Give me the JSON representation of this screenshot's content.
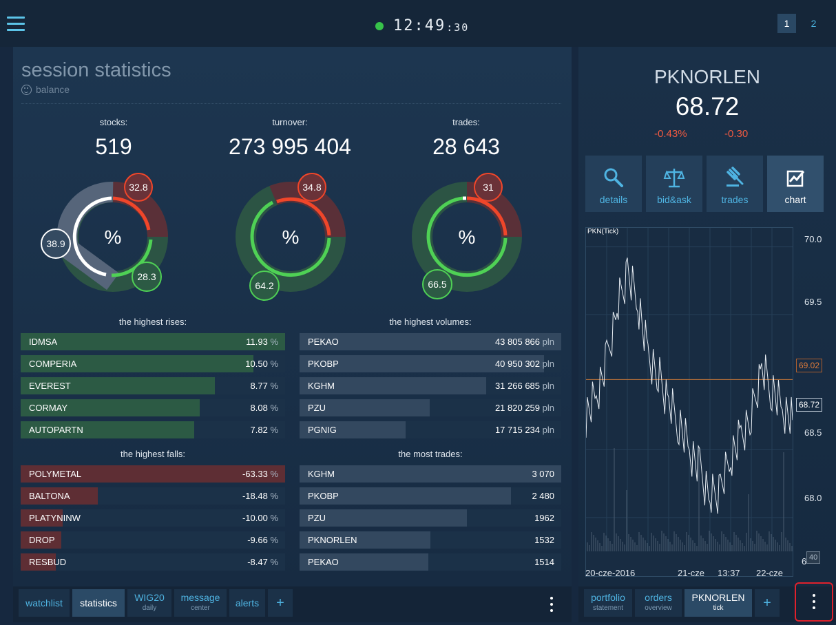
{
  "header": {
    "clock_hm": "12:49",
    "clock_sec": ":30",
    "workspaces": [
      "1",
      "2"
    ],
    "colors": {
      "accent": "#4fb4e2",
      "up": "#4fd155",
      "down": "#f0462a",
      "live": "#37c24a"
    }
  },
  "session": {
    "title": "session statistics",
    "subtitle": "balance",
    "stats": [
      {
        "label": "stocks:",
        "value": "519",
        "up": "28.3",
        "down": "32.8",
        "flat": "38.9",
        "center": "%"
      },
      {
        "label": "turnover:",
        "value": "273 995 404",
        "up": "64.2",
        "down": "34.8",
        "center": "%"
      },
      {
        "label": "trades:",
        "value": "28 643",
        "up": "66.5",
        "down": "31",
        "center": "%"
      }
    ],
    "rises": {
      "title": "the highest rises:",
      "rows": [
        {
          "name": "IDMSA",
          "value": "11.93",
          "unit": "%",
          "level": 1.0
        },
        {
          "name": "COMPERIA",
          "value": "10.50",
          "unit": "%",
          "level": 0.88
        },
        {
          "name": "EVEREST",
          "value": "8.77",
          "unit": "%",
          "level": 0.735
        },
        {
          "name": "CORMAY",
          "value": "8.08",
          "unit": "%",
          "level": 0.677
        },
        {
          "name": "AUTOPARTN",
          "value": "7.82",
          "unit": "%",
          "level": 0.655
        }
      ]
    },
    "volumes": {
      "title": "the highest volumes:",
      "rows": [
        {
          "name": "PEKAO",
          "value": "43 805 866",
          "unit": "pln",
          "level": 1.0
        },
        {
          "name": "PKOBP",
          "value": "40 950 302",
          "unit": "pln",
          "level": 0.935
        },
        {
          "name": "KGHM",
          "value": "31 266 685",
          "unit": "pln",
          "level": 0.714
        },
        {
          "name": "PZU",
          "value": "21 820 259",
          "unit": "pln",
          "level": 0.498
        },
        {
          "name": "PGNIG",
          "value": "17 715 234",
          "unit": "pln",
          "level": 0.404
        }
      ]
    },
    "falls": {
      "title": "the highest falls:",
      "rows": [
        {
          "name": "POLYMETAL",
          "value": "-63.33",
          "unit": "%",
          "level": 1.0
        },
        {
          "name": "BALTONA",
          "value": "-18.48",
          "unit": "%",
          "level": 0.292
        },
        {
          "name": "PLATYNINW",
          "value": "-10.00",
          "unit": "%",
          "level": 0.158
        },
        {
          "name": "DROP",
          "value": "-9.66",
          "unit": "%",
          "level": 0.153
        },
        {
          "name": "RESBUD",
          "value": "-8.47",
          "unit": "%",
          "level": 0.134
        }
      ]
    },
    "trades": {
      "title": "the most trades:",
      "rows": [
        {
          "name": "KGHM",
          "value": "3 070",
          "unit": "",
          "level": 1.0
        },
        {
          "name": "PKOBP",
          "value": "2 480",
          "unit": "",
          "level": 0.808
        },
        {
          "name": "PZU",
          "value": "1962",
          "unit": "",
          "level": 0.639
        },
        {
          "name": "PKNORLEN",
          "value": "1532",
          "unit": "",
          "level": 0.499
        },
        {
          "name": "PEKAO",
          "value": "1514",
          "unit": "",
          "level": 0.493
        }
      ]
    }
  },
  "bottom_tabs": {
    "watchlist": "watchlist",
    "statistics": "statistics",
    "wig20": "WIG20",
    "wig20_sub": "daily",
    "message": "message",
    "message_sub": "center",
    "alerts": "alerts",
    "add": "+"
  },
  "instrument": {
    "name": "PKNORLEN",
    "price": "68.72",
    "change_pct": "-0.43%",
    "change_abs": "-0.30",
    "actions": [
      "details",
      "bid&ask",
      "trades",
      "chart"
    ],
    "chart": {
      "label": "PKN(Tick)",
      "y_ticks": [
        "70.0",
        "69.5",
        "69.0",
        "68.5",
        "68.0"
      ],
      "ref_tag": "69.02",
      "last_tag": "68.72",
      "x_labels": [
        "20-cze-2016",
        "21-cze",
        "13:37",
        "22-cze"
      ],
      "ticker_fragment": "6",
      "ticker_box": "40"
    }
  },
  "right_tabs": {
    "portfolio": "portfolio",
    "portfolio_sub": "statement",
    "orders": "orders",
    "orders_sub": "overview",
    "pkn": "PKNORLEN",
    "pkn_sub": "tick",
    "add": "+"
  },
  "chart_data": {
    "type": "line",
    "title": "PKN(Tick)",
    "xlabel": "",
    "ylabel": "",
    "ylim": [
      67.75,
      70.1
    ],
    "x_ticks": [
      "20-cze-2016",
      "21-cze",
      "13:37",
      "22-cze"
    ],
    "series": [
      {
        "x": [
          0,
          5,
          10,
          15,
          20,
          25,
          30,
          35,
          40,
          45,
          50,
          55,
          60,
          65,
          70,
          75,
          80,
          85,
          90,
          95,
          100
        ],
        "values": [
          68.75,
          68.9,
          69.15,
          69.55,
          69.8,
          69.6,
          69.2,
          69.05,
          68.85,
          68.7,
          68.5,
          68.35,
          68.15,
          68.2,
          68.45,
          68.6,
          68.75,
          69.1,
          68.95,
          68.8,
          68.72
        ]
      }
    ],
    "reference_line": 69.02,
    "last_value": 68.72
  }
}
